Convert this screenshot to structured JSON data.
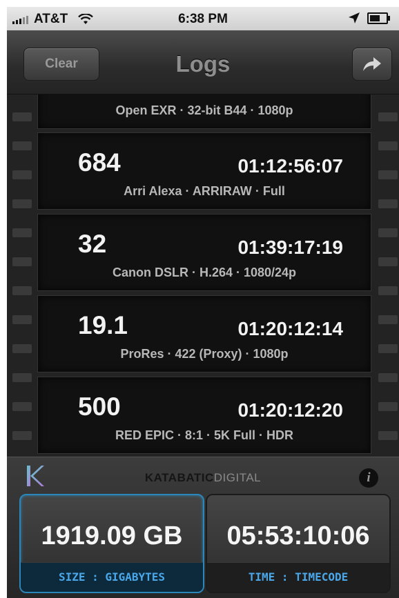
{
  "status_bar": {
    "carrier": "AT&T",
    "time": "6:38 PM",
    "icons": [
      "signal-bars-icon",
      "wifi-icon",
      "location-arrow-icon",
      "battery-icon"
    ]
  },
  "nav": {
    "clear_label": "Clear",
    "title": "Logs",
    "share_icon": "forward-arrow-icon"
  },
  "logs": [
    {
      "number": "",
      "timecode": "",
      "description": "Open EXR · 32-bit B44 · 1080p"
    },
    {
      "number": "684",
      "timecode": "01:12:56:07",
      "description": "Arri Alexa · ARRIRAW · Full"
    },
    {
      "number": "32",
      "timecode": "01:39:17:19",
      "description": "Canon DSLR · H.264 · 1080/24p"
    },
    {
      "number": "19.1",
      "timecode": "01:20:12:14",
      "description": "ProRes · 422 (Proxy) · 1080p"
    },
    {
      "number": "500",
      "timecode": "01:20:12:20",
      "description": "RED EPIC · 8:1 · 5K Full · HDR"
    }
  ],
  "panel": {
    "logo_icon": "k-logo-icon",
    "brand_bold": "KATABATIC",
    "brand_light": "DIGITAL",
    "info_icon": "info-icon",
    "size": {
      "value": "1919.09 GB",
      "label": "SIZE : GIGABYTES"
    },
    "time": {
      "value": "05:53:10:06",
      "label": "TIME : TIMECODE"
    }
  },
  "colors": {
    "accent_blue": "#2b86b9",
    "label_blue": "#4aa8ea",
    "logo_teal": "#5ec9c9",
    "logo_purple": "#b07cd8"
  }
}
